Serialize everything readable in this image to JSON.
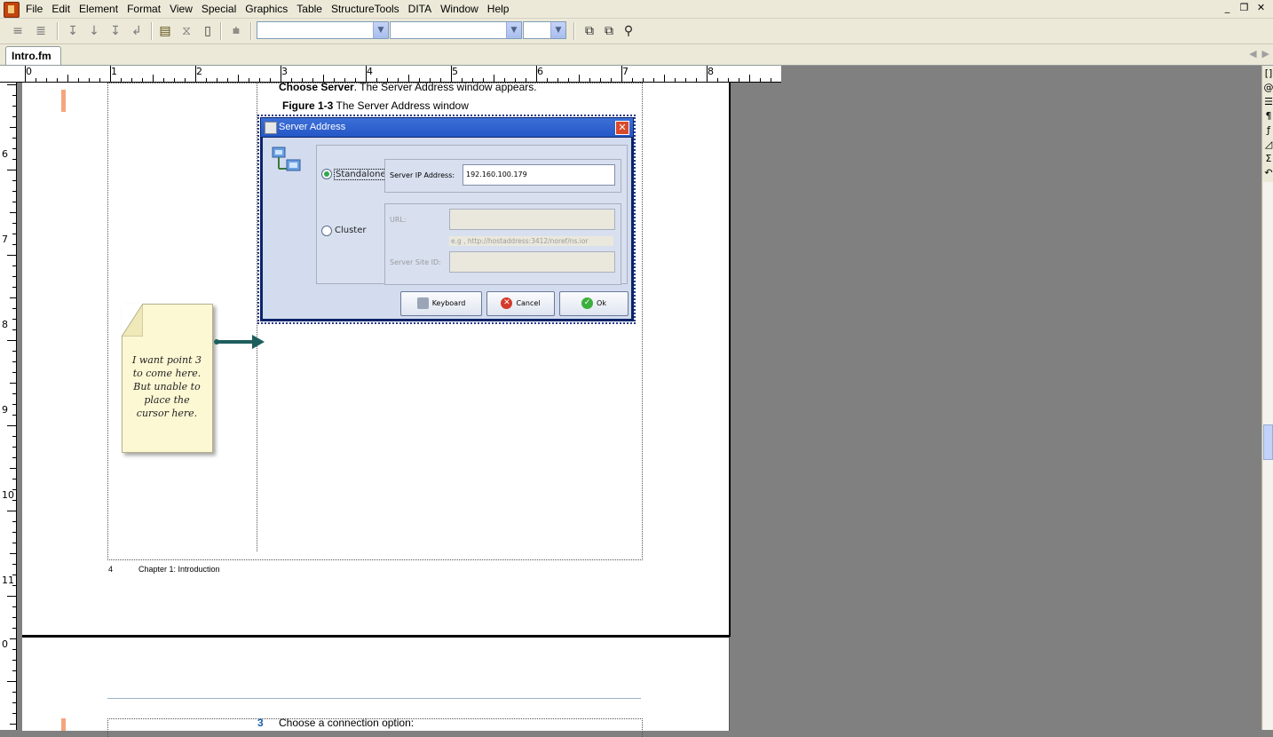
{
  "menu": [
    "File",
    "Edit",
    "Element",
    "Format",
    "View",
    "Special",
    "Graphics",
    "Table",
    "StructureTools",
    "DITA",
    "Window",
    "Help"
  ],
  "window_controls": {
    "minimize": "_",
    "restore": "❐",
    "close": "✕"
  },
  "toolbar": {
    "font_select": "",
    "size_select": "",
    "style_select": ""
  },
  "tab": {
    "label": "Intro.fm"
  },
  "ruler": {
    "h_numbers": [
      "0",
      "1",
      "2",
      "3",
      "4",
      "5",
      "6",
      "7",
      "8"
    ],
    "v_numbers": [
      "6",
      "7",
      "8",
      "9",
      "10",
      "11",
      "0"
    ]
  },
  "document": {
    "top_text_bold": "Choose Server",
    "top_text_rest": ". The Server Address window appears.",
    "figure_label": "Figure 1-3",
    "figure_caption": "The Server Address window",
    "footer_page": "4",
    "footer_chapter": "Chapter 1: Introduction",
    "next_step_number": "3",
    "next_step_text": "Choose a connection option:"
  },
  "dialog": {
    "title": "Server Address",
    "standalone_label": "Standalone",
    "cluster_label": "Cluster",
    "server_ip_label": "Server IP Address:",
    "server_ip_value": "192.160.100.179",
    "url_label": "URL:",
    "url_value": "",
    "url_hint": "e.g , http://hostaddress:3412/noref/ns.ior",
    "server_site_label": "Server Site ID:",
    "server_site_value": "",
    "keyboard_button": "Keyboard",
    "cancel_button": "Cancel",
    "ok_button": "Ok",
    "standalone_selected": true
  },
  "note": {
    "text": "I want point 3 to come here. But unable to place the cursor here."
  },
  "colors": {
    "workspace_bg": "#808080",
    "chrome_bg": "#ece9d8",
    "change_bar": "#f4a57c",
    "dialog_title": "#2457c7",
    "note_bg": "#fdf8d4",
    "arrow": "#1f5e5e"
  }
}
